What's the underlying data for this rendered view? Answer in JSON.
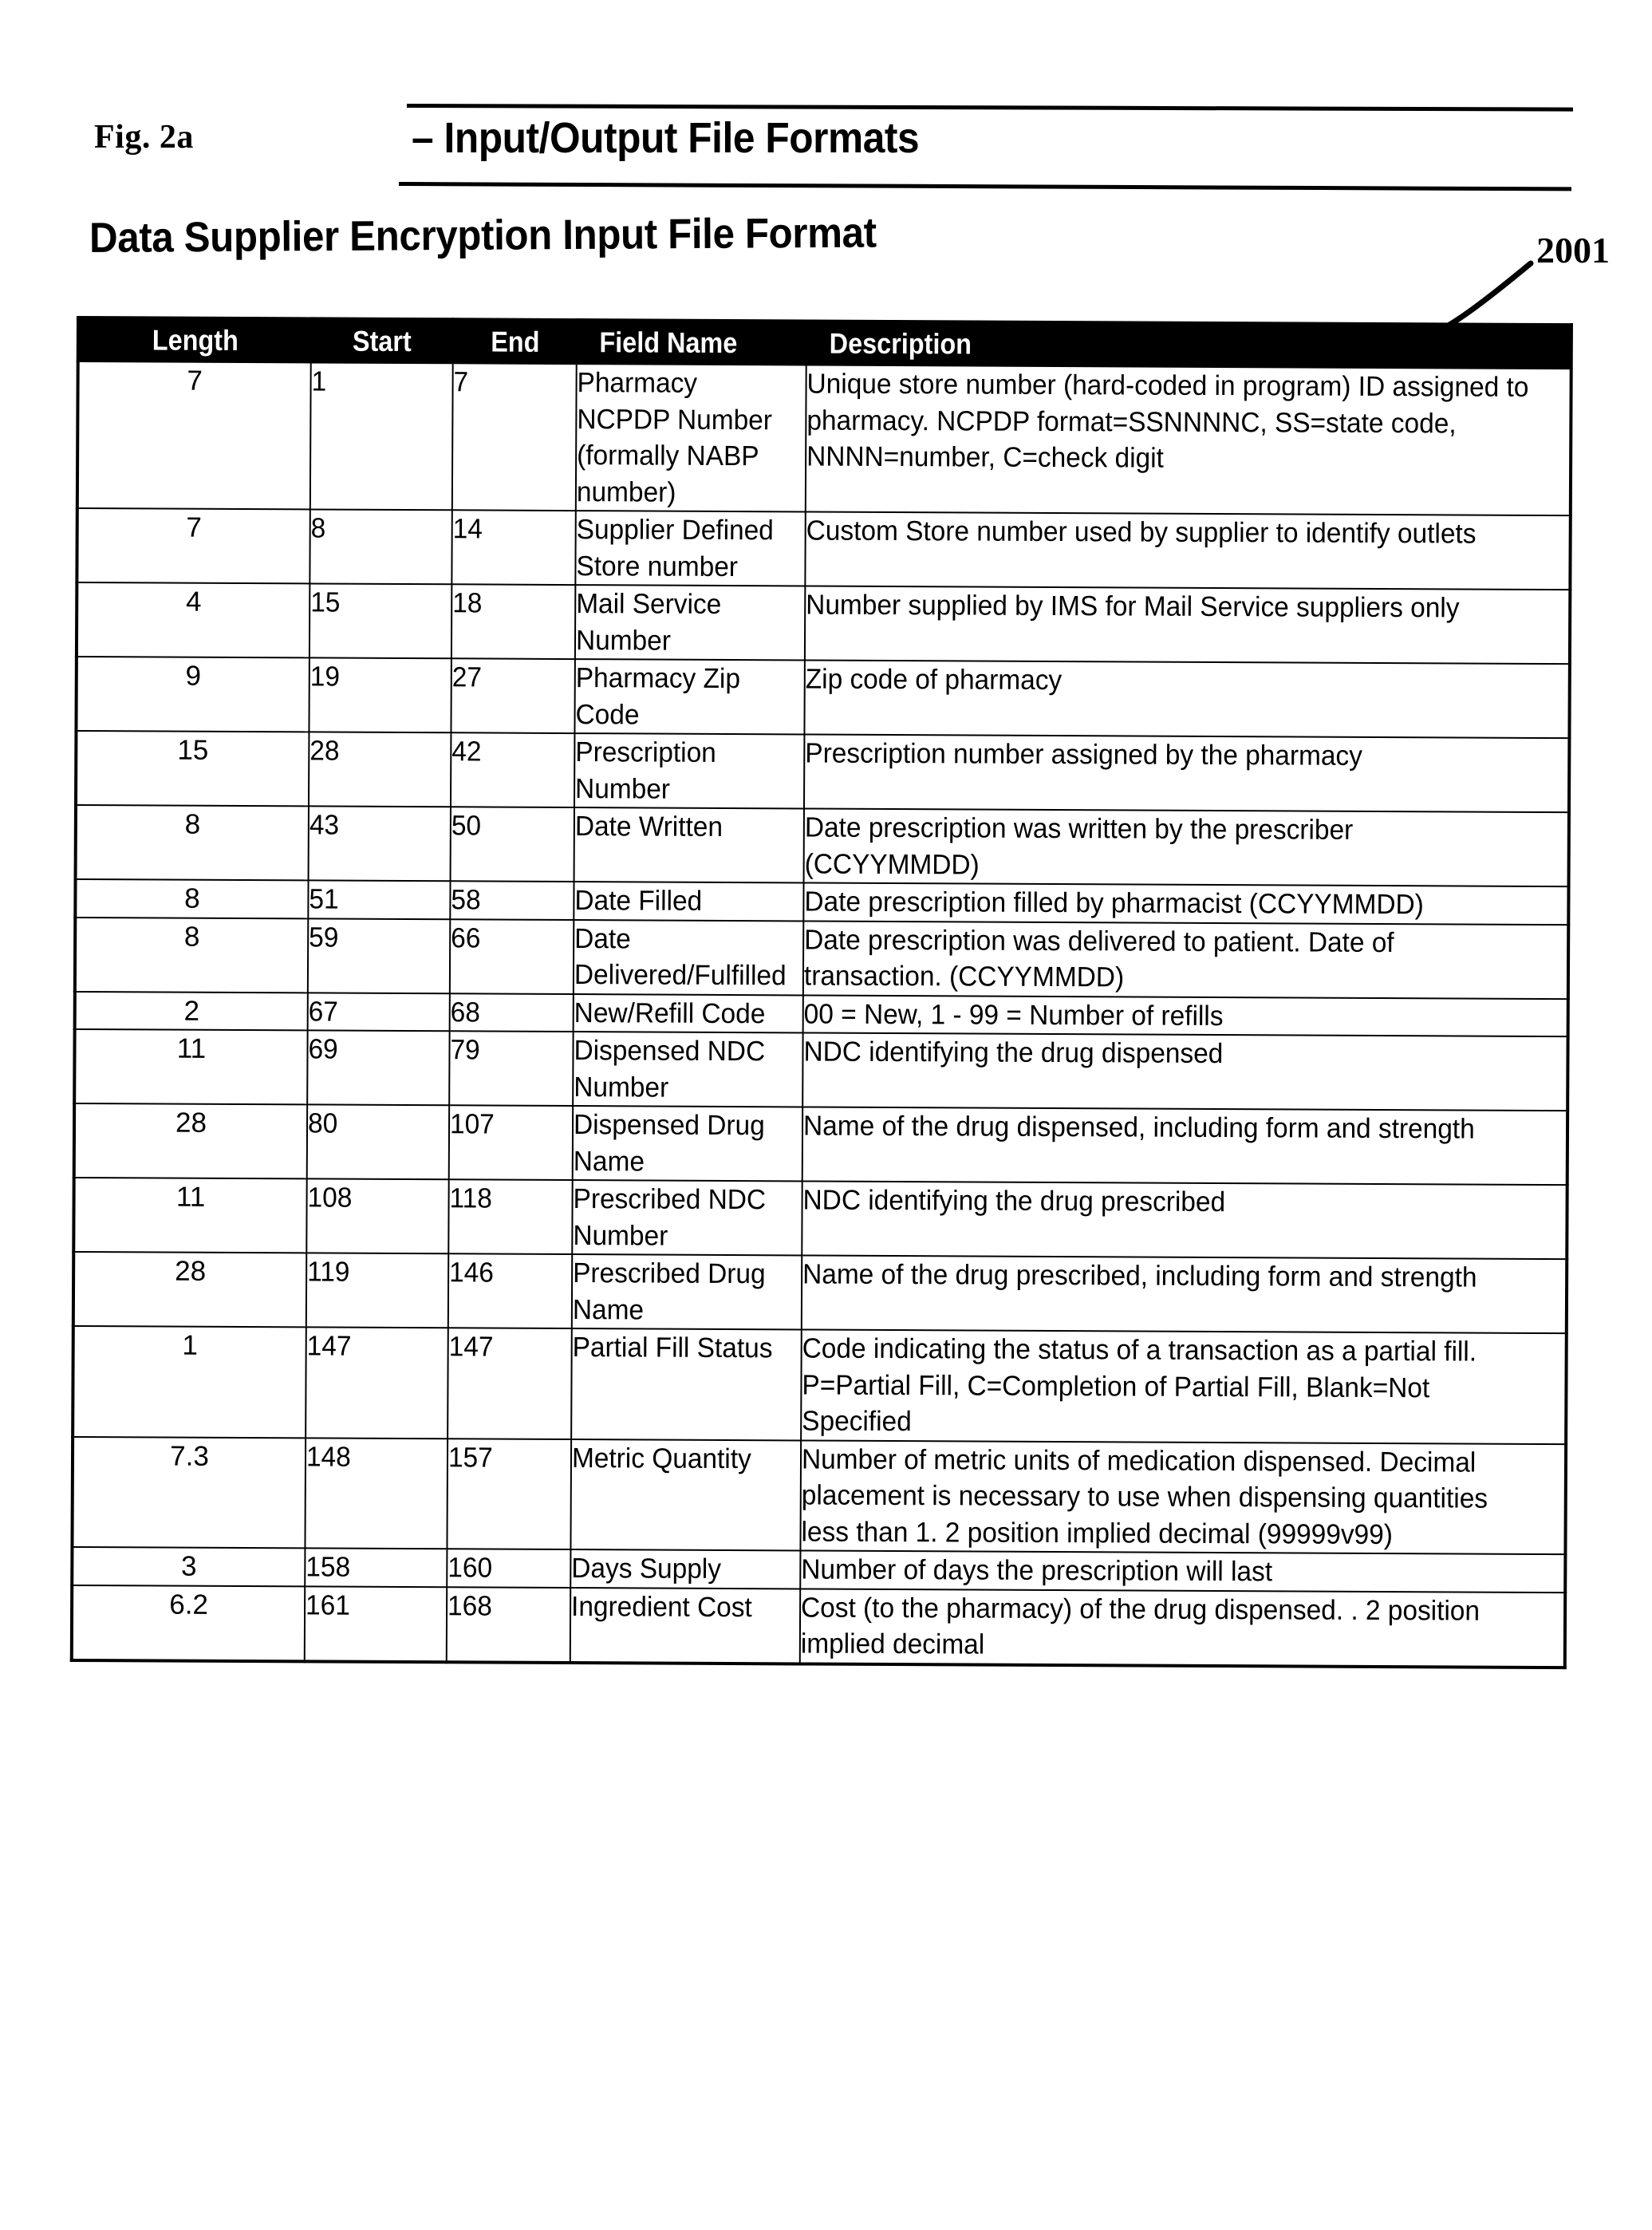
{
  "figure": {
    "label": "Fig. 2a",
    "title": "– Input/Output File Formats"
  },
  "section": {
    "heading": "Data Supplier Encryption Input File Format",
    "reference_number": "2001"
  },
  "table": {
    "columns": [
      "Length",
      "Start",
      "End",
      "Field Name",
      "Description"
    ],
    "rows": [
      {
        "length": "7",
        "start": "1",
        "end": "7",
        "field": "Pharmacy NCPDP Number (formally NABP number)",
        "description": "Unique store number (hard-coded in program) ID assigned to pharmacy. NCPDP format=SSNNNNC, SS=state code, NNNN=number, C=check digit"
      },
      {
        "length": "7",
        "start": "8",
        "end": "14",
        "field": "Supplier Defined Store number",
        "description": "Custom Store number used by supplier to identify outlets"
      },
      {
        "length": "4",
        "start": "15",
        "end": "18",
        "field": "Mail Service Number",
        "description": "Number supplied by IMS for Mail Service suppliers only"
      },
      {
        "length": "9",
        "start": "19",
        "end": "27",
        "field": "Pharmacy Zip Code",
        "description": "Zip code of pharmacy"
      },
      {
        "length": "15",
        "start": "28",
        "end": "42",
        "field": "Prescription Number",
        "description": "Prescription number assigned by the pharmacy"
      },
      {
        "length": "8",
        "start": "43",
        "end": "50",
        "field": "Date Written",
        "description": "Date prescription was written by the prescriber (CCYYMMDD)"
      },
      {
        "length": "8",
        "start": "51",
        "end": "58",
        "field": "Date Filled",
        "description": "Date prescription filled by pharmacist (CCYYMMDD)"
      },
      {
        "length": "8",
        "start": "59",
        "end": "66",
        "field": "Date Delivered/Fulfilled",
        "description": "Date prescription was delivered to patient.  Date of transaction. (CCYYMMDD)"
      },
      {
        "length": "2",
        "start": "67",
        "end": "68",
        "field": "New/Refill Code",
        "description": "00 = New, 1 - 99 = Number of refills"
      },
      {
        "length": "11",
        "start": "69",
        "end": "79",
        "field": "Dispensed NDC Number",
        "description": "NDC identifying the drug dispensed"
      },
      {
        "length": "28",
        "start": "80",
        "end": "107",
        "field": "Dispensed Drug Name",
        "description": "Name of the drug dispensed, including form and strength"
      },
      {
        "length": "11",
        "start": "108",
        "end": "118",
        "field": "Prescribed NDC Number",
        "description": "NDC identifying the drug prescribed"
      },
      {
        "length": "28",
        "start": "119",
        "end": "146",
        "field": "Prescribed Drug Name",
        "description": "Name of the drug prescribed, including form and strength"
      },
      {
        "length": "1",
        "start": "147",
        "end": "147",
        "field": "Partial Fill Status",
        "description": "Code indicating the status of a transaction as a partial fill.   P=Partial Fill, C=Completion of Partial Fill, Blank=Not Specified"
      },
      {
        "length": "7.3",
        "start": "148",
        "end": "157",
        "field": "Metric Quantity",
        "description": "Number of metric units of medication dispensed.  Decimal placement is necessary to use when dispensing quantities less than 1.  2 position implied decimal (99999v99)"
      },
      {
        "length": "3",
        "start": "158",
        "end": "160",
        "field": "Days Supply",
        "description": "Number of days the prescription will last"
      },
      {
        "length": "6.2",
        "start": "161",
        "end": "168",
        "field": "Ingredient Cost",
        "description": "Cost (to the pharmacy) of the drug dispensed. . 2 position implied decimal"
      }
    ]
  }
}
